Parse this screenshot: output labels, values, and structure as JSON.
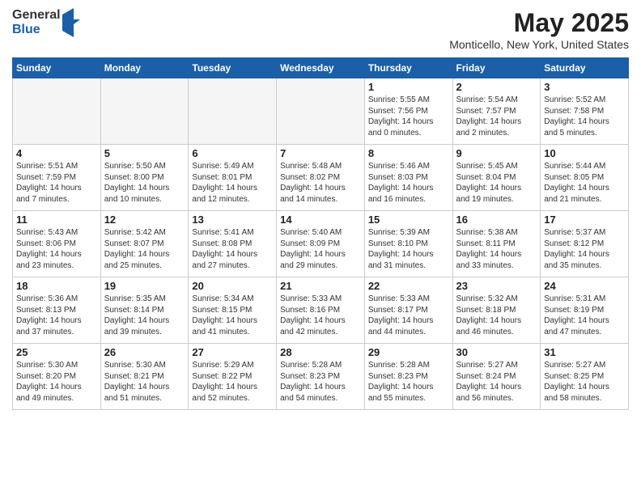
{
  "header": {
    "logo_general": "General",
    "logo_blue": "Blue",
    "title": "May 2025",
    "subtitle": "Monticello, New York, United States"
  },
  "weekdays": [
    "Sunday",
    "Monday",
    "Tuesday",
    "Wednesday",
    "Thursday",
    "Friday",
    "Saturday"
  ],
  "weeks": [
    [
      {
        "day": "",
        "info": ""
      },
      {
        "day": "",
        "info": ""
      },
      {
        "day": "",
        "info": ""
      },
      {
        "day": "",
        "info": ""
      },
      {
        "day": "1",
        "info": "Sunrise: 5:55 AM\nSunset: 7:56 PM\nDaylight: 14 hours\nand 0 minutes."
      },
      {
        "day": "2",
        "info": "Sunrise: 5:54 AM\nSunset: 7:57 PM\nDaylight: 14 hours\nand 2 minutes."
      },
      {
        "day": "3",
        "info": "Sunrise: 5:52 AM\nSunset: 7:58 PM\nDaylight: 14 hours\nand 5 minutes."
      }
    ],
    [
      {
        "day": "4",
        "info": "Sunrise: 5:51 AM\nSunset: 7:59 PM\nDaylight: 14 hours\nand 7 minutes."
      },
      {
        "day": "5",
        "info": "Sunrise: 5:50 AM\nSunset: 8:00 PM\nDaylight: 14 hours\nand 10 minutes."
      },
      {
        "day": "6",
        "info": "Sunrise: 5:49 AM\nSunset: 8:01 PM\nDaylight: 14 hours\nand 12 minutes."
      },
      {
        "day": "7",
        "info": "Sunrise: 5:48 AM\nSunset: 8:02 PM\nDaylight: 14 hours\nand 14 minutes."
      },
      {
        "day": "8",
        "info": "Sunrise: 5:46 AM\nSunset: 8:03 PM\nDaylight: 14 hours\nand 16 minutes."
      },
      {
        "day": "9",
        "info": "Sunrise: 5:45 AM\nSunset: 8:04 PM\nDaylight: 14 hours\nand 19 minutes."
      },
      {
        "day": "10",
        "info": "Sunrise: 5:44 AM\nSunset: 8:05 PM\nDaylight: 14 hours\nand 21 minutes."
      }
    ],
    [
      {
        "day": "11",
        "info": "Sunrise: 5:43 AM\nSunset: 8:06 PM\nDaylight: 14 hours\nand 23 minutes."
      },
      {
        "day": "12",
        "info": "Sunrise: 5:42 AM\nSunset: 8:07 PM\nDaylight: 14 hours\nand 25 minutes."
      },
      {
        "day": "13",
        "info": "Sunrise: 5:41 AM\nSunset: 8:08 PM\nDaylight: 14 hours\nand 27 minutes."
      },
      {
        "day": "14",
        "info": "Sunrise: 5:40 AM\nSunset: 8:09 PM\nDaylight: 14 hours\nand 29 minutes."
      },
      {
        "day": "15",
        "info": "Sunrise: 5:39 AM\nSunset: 8:10 PM\nDaylight: 14 hours\nand 31 minutes."
      },
      {
        "day": "16",
        "info": "Sunrise: 5:38 AM\nSunset: 8:11 PM\nDaylight: 14 hours\nand 33 minutes."
      },
      {
        "day": "17",
        "info": "Sunrise: 5:37 AM\nSunset: 8:12 PM\nDaylight: 14 hours\nand 35 minutes."
      }
    ],
    [
      {
        "day": "18",
        "info": "Sunrise: 5:36 AM\nSunset: 8:13 PM\nDaylight: 14 hours\nand 37 minutes."
      },
      {
        "day": "19",
        "info": "Sunrise: 5:35 AM\nSunset: 8:14 PM\nDaylight: 14 hours\nand 39 minutes."
      },
      {
        "day": "20",
        "info": "Sunrise: 5:34 AM\nSunset: 8:15 PM\nDaylight: 14 hours\nand 41 minutes."
      },
      {
        "day": "21",
        "info": "Sunrise: 5:33 AM\nSunset: 8:16 PM\nDaylight: 14 hours\nand 42 minutes."
      },
      {
        "day": "22",
        "info": "Sunrise: 5:33 AM\nSunset: 8:17 PM\nDaylight: 14 hours\nand 44 minutes."
      },
      {
        "day": "23",
        "info": "Sunrise: 5:32 AM\nSunset: 8:18 PM\nDaylight: 14 hours\nand 46 minutes."
      },
      {
        "day": "24",
        "info": "Sunrise: 5:31 AM\nSunset: 8:19 PM\nDaylight: 14 hours\nand 47 minutes."
      }
    ],
    [
      {
        "day": "25",
        "info": "Sunrise: 5:30 AM\nSunset: 8:20 PM\nDaylight: 14 hours\nand 49 minutes."
      },
      {
        "day": "26",
        "info": "Sunrise: 5:30 AM\nSunset: 8:21 PM\nDaylight: 14 hours\nand 51 minutes."
      },
      {
        "day": "27",
        "info": "Sunrise: 5:29 AM\nSunset: 8:22 PM\nDaylight: 14 hours\nand 52 minutes."
      },
      {
        "day": "28",
        "info": "Sunrise: 5:28 AM\nSunset: 8:23 PM\nDaylight: 14 hours\nand 54 minutes."
      },
      {
        "day": "29",
        "info": "Sunrise: 5:28 AM\nSunset: 8:23 PM\nDaylight: 14 hours\nand 55 minutes."
      },
      {
        "day": "30",
        "info": "Sunrise: 5:27 AM\nSunset: 8:24 PM\nDaylight: 14 hours\nand 56 minutes."
      },
      {
        "day": "31",
        "info": "Sunrise: 5:27 AM\nSunset: 8:25 PM\nDaylight: 14 hours\nand 58 minutes."
      }
    ]
  ]
}
